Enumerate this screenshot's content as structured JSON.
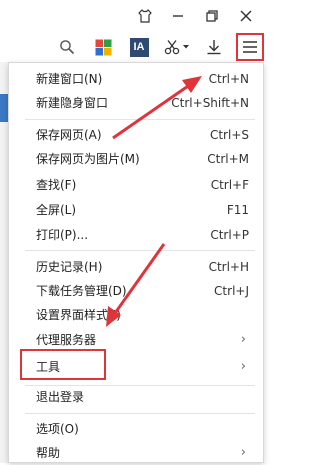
{
  "menu": {
    "items": [
      {
        "label": "新建窗口(N)",
        "shortcut": "Ctrl+N"
      },
      {
        "label": "新建隐身窗口",
        "shortcut": "Ctrl+Shift+N"
      },
      {
        "label": "保存网页(A)",
        "shortcut": "Ctrl+S"
      },
      {
        "label": "保存网页为图片(M)",
        "shortcut": "Ctrl+M"
      },
      {
        "label": "查找(F)",
        "shortcut": "Ctrl+F"
      },
      {
        "label": "全屏(L)",
        "shortcut": "F11"
      },
      {
        "label": "打印(P)...",
        "shortcut": "Ctrl+P"
      },
      {
        "label": "历史记录(H)",
        "shortcut": "Ctrl+H"
      },
      {
        "label": "下载任务管理(D)",
        "shortcut": "Ctrl+J"
      },
      {
        "label": "设置界面样式(I)",
        "shortcut": ""
      },
      {
        "label": "代理服务器",
        "shortcut": ""
      },
      {
        "label": "工具",
        "shortcut": ""
      },
      {
        "label": "退出登录",
        "shortcut": ""
      },
      {
        "label": "选项(O)",
        "shortcut": ""
      },
      {
        "label": "帮助",
        "shortcut": ""
      }
    ]
  },
  "toolbar": {
    "ia_label": "IA"
  },
  "colors": {
    "annotation_red": "#e0343b",
    "accent_blue": "#3b78c4"
  }
}
